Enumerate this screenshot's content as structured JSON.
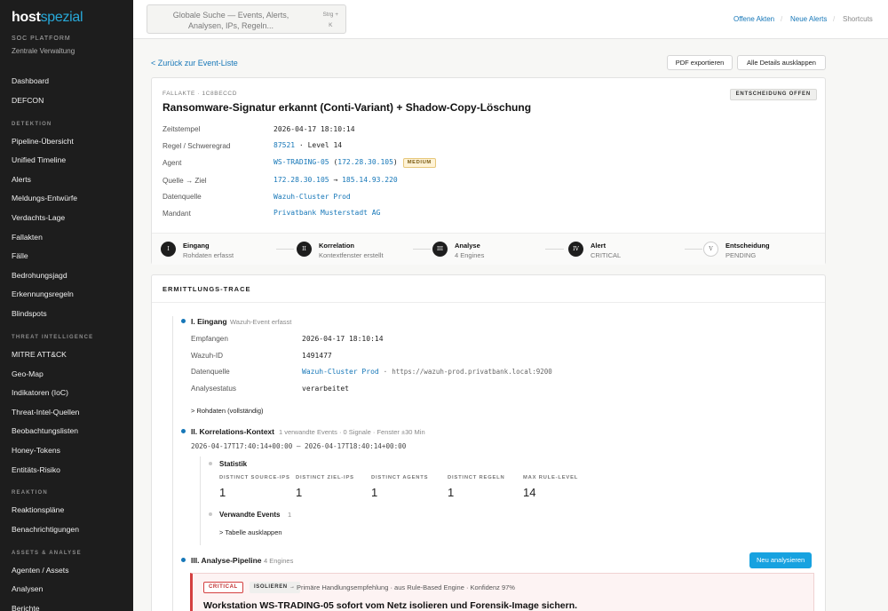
{
  "sidebar": {
    "logo_a": "host",
    "logo_b": "spezial",
    "subtitle": "SOC PLATFORM",
    "subtitle2": "Zentrale Verwaltung",
    "items_top": [
      "Dashboard",
      "DEFCON"
    ],
    "sec_detektion": "DETEKTION",
    "items_detektion": [
      "Pipeline-Übersicht",
      "Unified Timeline",
      "Alerts",
      "Meldungs-Entwürfe",
      "Verdachts-Lage",
      "Fallakten",
      "Fälle",
      "Bedrohungsjagd",
      "Erkennungsregeln",
      "Blindspots"
    ],
    "sec_ti": "THREAT INTELLIGENCE",
    "items_ti": [
      "MITRE ATT&CK",
      "Geo-Map",
      "Indikatoren (IoC)",
      "Threat-Intel-Quellen",
      "Beobachtungslisten",
      "Honey-Tokens",
      "Entitäts-Risiko"
    ],
    "sec_reaktion": "REAKTION",
    "items_reaktion": [
      "Reaktionspläne",
      "Benachrichtigungen"
    ],
    "sec_assets": "ASSETS & ANALYSE",
    "items_assets": [
      "Agenten / Assets",
      "Analysen",
      "Berichte"
    ]
  },
  "topbar": {
    "search_placeholder": "Globale Suche — Events, Alerts, Analysen, IPs, Regeln...",
    "shortcut_a": "Strg +",
    "shortcut_b": "K",
    "links": [
      "Offene Akten",
      "Neue Alerts",
      "Shortcuts"
    ],
    "sep": "/"
  },
  "main": {
    "back": "< Zurück zur Event-Liste",
    "btn_pdf": "PDF exportieren",
    "btn_expand": "Alle Details ausklappen"
  },
  "case": {
    "kicker": "FALLAKTE · 1C8BECCD",
    "status": "ENTSCHEIDUNG OFFEN",
    "title": "Ransomware-Signatur erkannt (Conti-Variant) + Shadow-Copy-Löschung",
    "labels": {
      "time": "Zeitstempel",
      "rule": "Regel / Schweregrad",
      "agent": "Agent",
      "srcdst": "Quelle → Ziel",
      "source": "Datenquelle",
      "tenant": "Mandant"
    },
    "time": "2026-04-17 18:10:14",
    "rule_id": "87521",
    "rule_sep": "·",
    "rule_level": "Level 14",
    "agent_name": "WS-TRADING-05",
    "agent_ip_open": "(",
    "agent_ip": "172.28.30.105",
    "agent_ip_close": ")",
    "agent_sev": "MEDIUM",
    "src_ip": "172.28.30.105",
    "arrow": "→",
    "dst_ip": "185.14.93.220",
    "datasource": "Wazuh-Cluster Prod",
    "tenant": "Privatbank Musterstadt AG",
    "steps": [
      {
        "num": "I",
        "title": "Eingang",
        "sub": "Rohdaten erfasst"
      },
      {
        "num": "II",
        "title": "Korrelation",
        "sub": "Kontextfenster erstellt"
      },
      {
        "num": "III",
        "title": "Analyse",
        "sub": "4 Engines"
      },
      {
        "num": "IV",
        "title": "Alert",
        "sub": "CRITICAL"
      },
      {
        "num": "V",
        "title": "Entscheidung",
        "sub": "PENDING"
      }
    ]
  },
  "trace": {
    "heading": "ERMITTLUNGS-TRACE",
    "eingang": {
      "title": "I. Eingang",
      "sub": "Wazuh-Event erfasst",
      "labels": {
        "recv": "Empfangen",
        "wid": "Wazuh-ID",
        "ds": "Datenquelle",
        "status": "Analysestatus"
      },
      "recv": "2026-04-17 18:10:14",
      "wid": "1491477",
      "ds_name": "Wazuh-Cluster Prod",
      "ds_sep": "·",
      "ds_url": "https://wazuh-prod.privatbank.local:9200",
      "status": "verarbeitet",
      "raw": "> Rohdaten (vollständig)"
    },
    "korr": {
      "title": "II. Korrelations-Kontext",
      "sub": "1 verwandte Events · 0 Signale · Fenster ±30 Min",
      "window": "2026-04-17T17:40:14+00:00 — 2026-04-17T18:40:14+00:00",
      "stat_title": "Statistik",
      "stats": [
        {
          "label": "DISTINCT SOURCE-IPS",
          "value": "1"
        },
        {
          "label": "DISTINCT ZIEL-IPS",
          "value": "1"
        },
        {
          "label": "DISTINCT AGENTS",
          "value": "1"
        },
        {
          "label": "DISTINCT REGELN",
          "value": "1"
        },
        {
          "label": "MAX RULE-LEVEL",
          "value": "14"
        }
      ],
      "related_title": "Verwandte Events",
      "related_count": "1",
      "table_link": "> Tabelle ausklappen"
    },
    "analyse": {
      "title": "III. Analyse-Pipeline",
      "sub": "4 Engines",
      "btn": "Neu analysieren",
      "crit": "CRITICAL",
      "action": "ISOLIEREN →",
      "rec": "Primäre Handlungsempfehlung · aus Rule-Based Engine · Konfidenz 97%",
      "headline": "Workstation WS-TRADING-05 sofort vom Netz isolieren und Forensik-Image sichern."
    }
  },
  "colors": {
    "accent": "#1677b8",
    "critical": "#d44040",
    "sidebar": "#1d1d1d"
  }
}
